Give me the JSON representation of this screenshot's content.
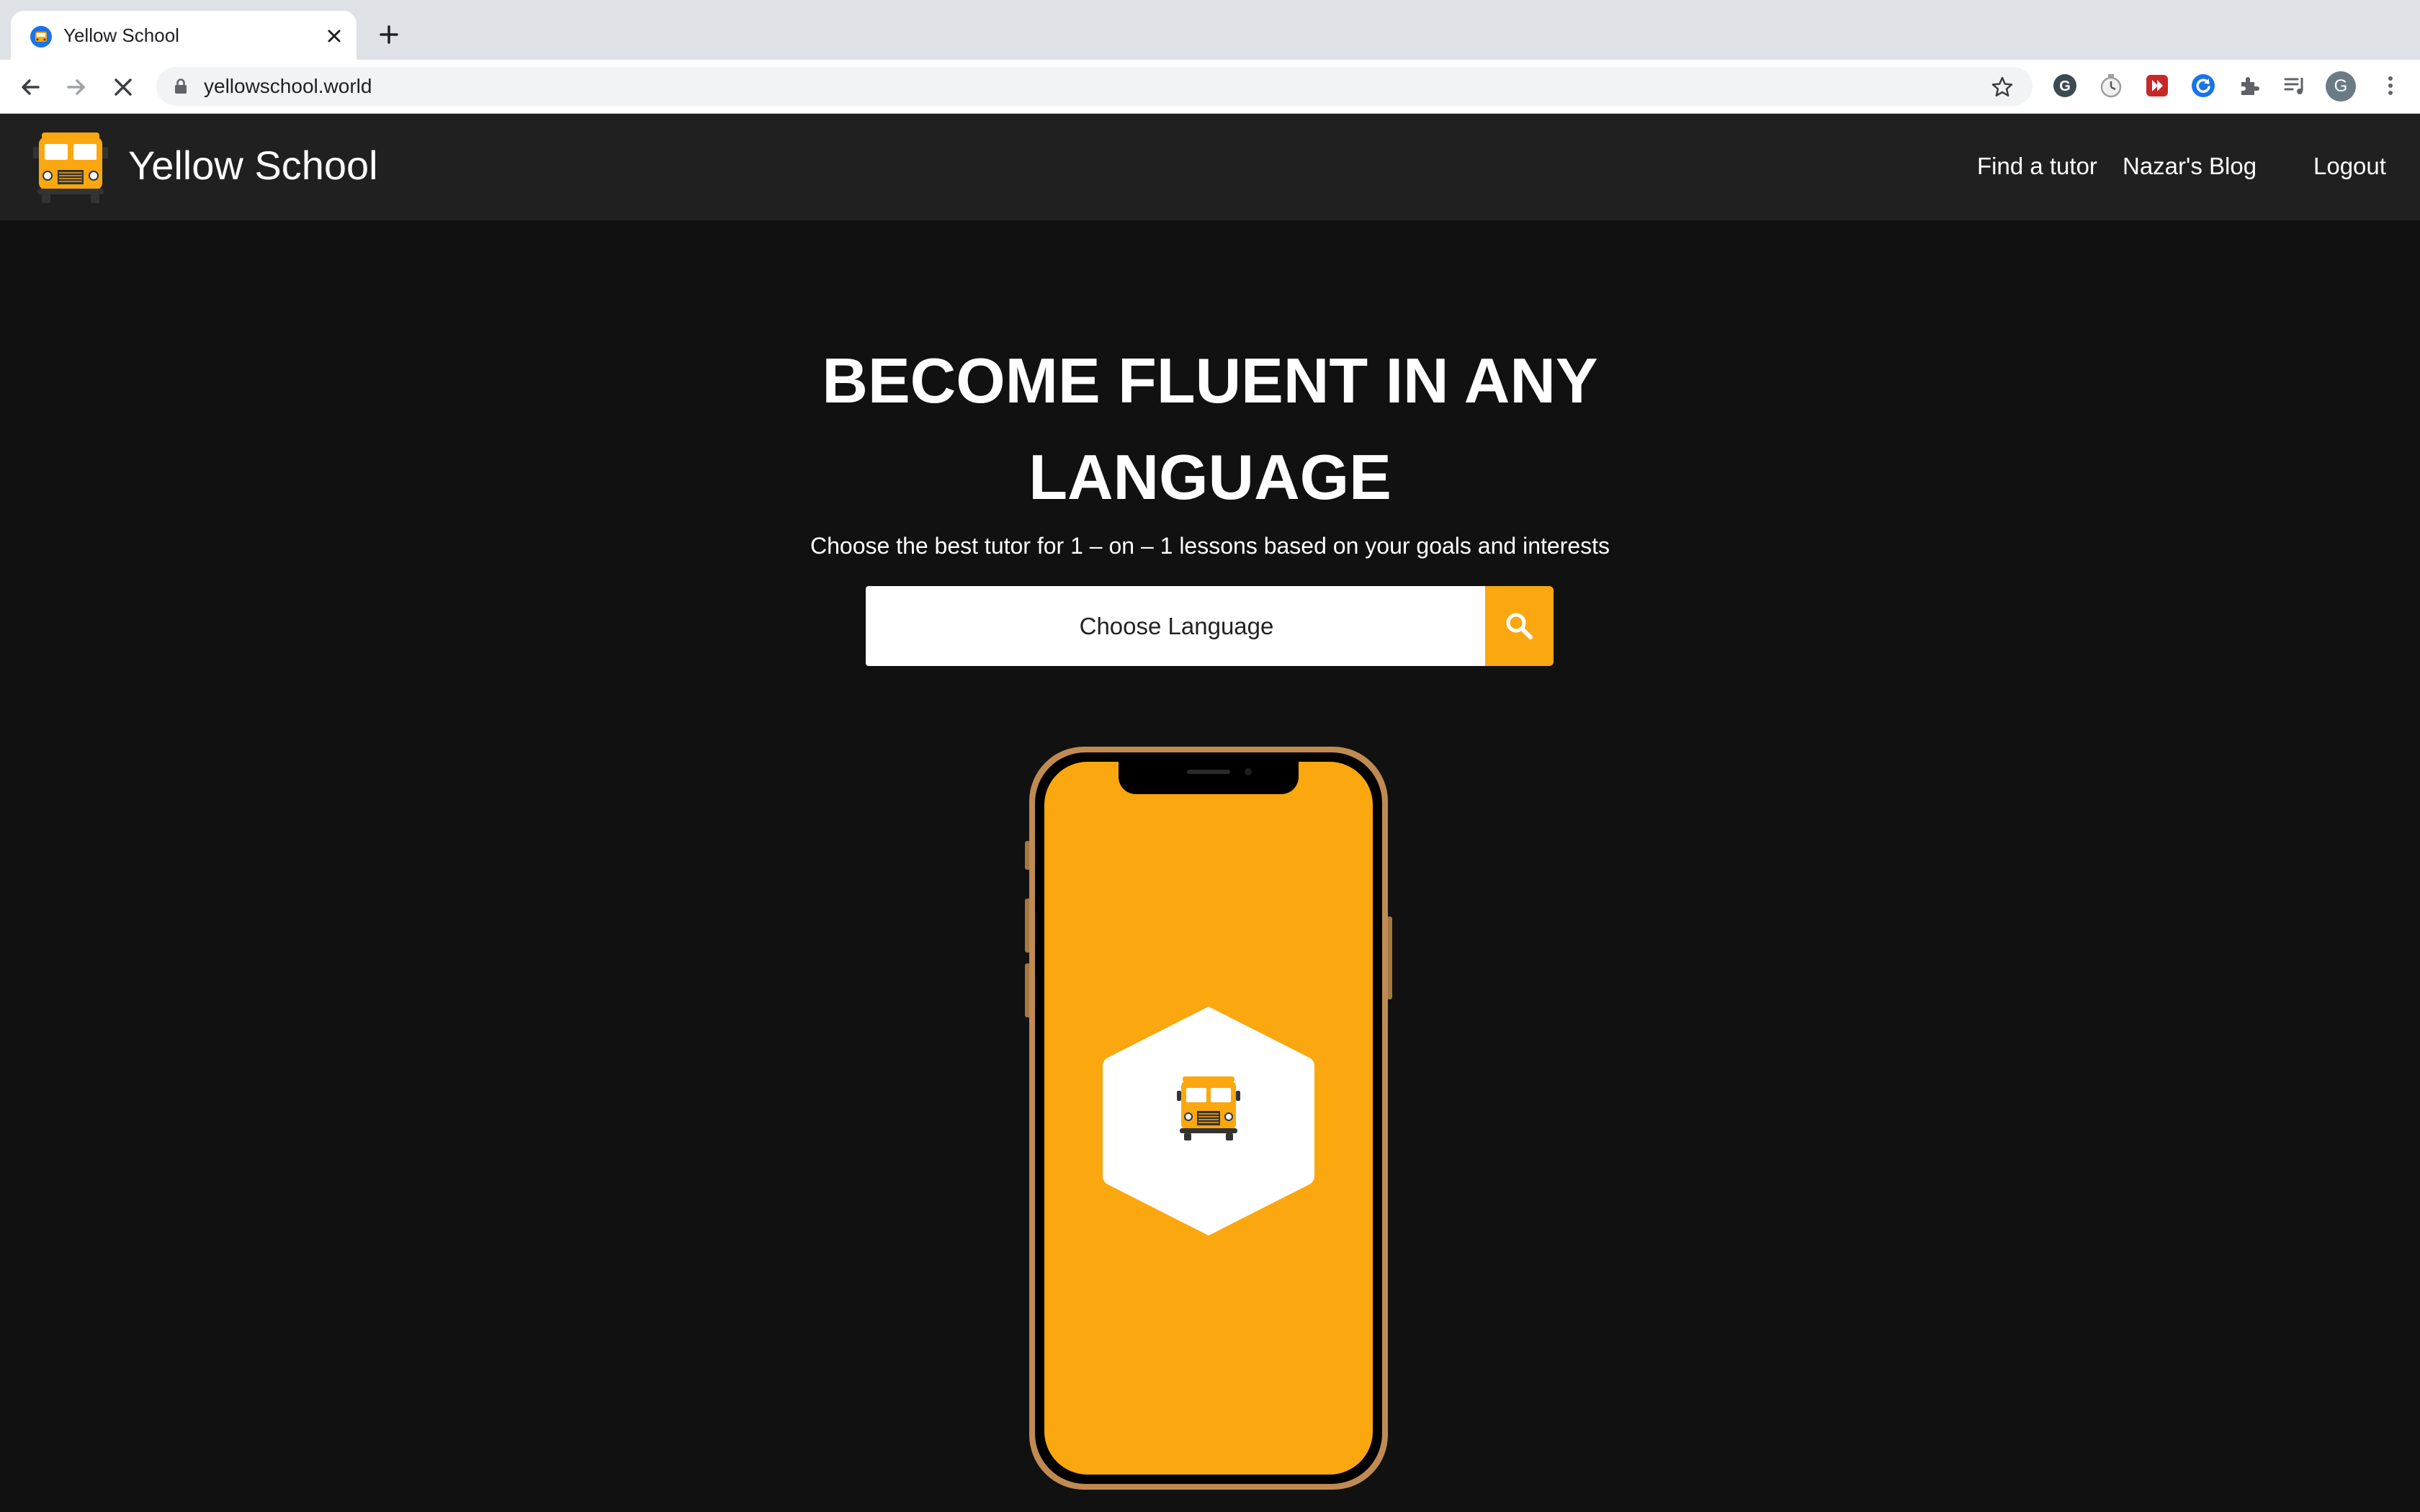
{
  "browser": {
    "tab_title": "Yellow School",
    "url": "yellowschool.world",
    "profile_initial": "G"
  },
  "site": {
    "brand": "Yellow School",
    "nav": {
      "find_tutor": "Find a tutor",
      "blog": "Nazar's Blog",
      "logout": "Logout"
    }
  },
  "hero": {
    "title_line1": "BECOME FLUENT IN ANY",
    "title_line2": "LANGUAGE",
    "subtitle": "Choose the best tutor for 1 – on – 1 lessons based on your goals and interests",
    "search_placeholder": "Choose Language"
  },
  "colors": {
    "accent": "#fba710",
    "page_background": "#111111",
    "header_background": "#202020"
  },
  "icons": [
    "bus-logo-icon",
    "search-icon",
    "back-icon",
    "forward-icon",
    "stop-loading-icon",
    "lock-icon",
    "star-icon",
    "extensions-icon",
    "media-icon",
    "menu-icon"
  ]
}
